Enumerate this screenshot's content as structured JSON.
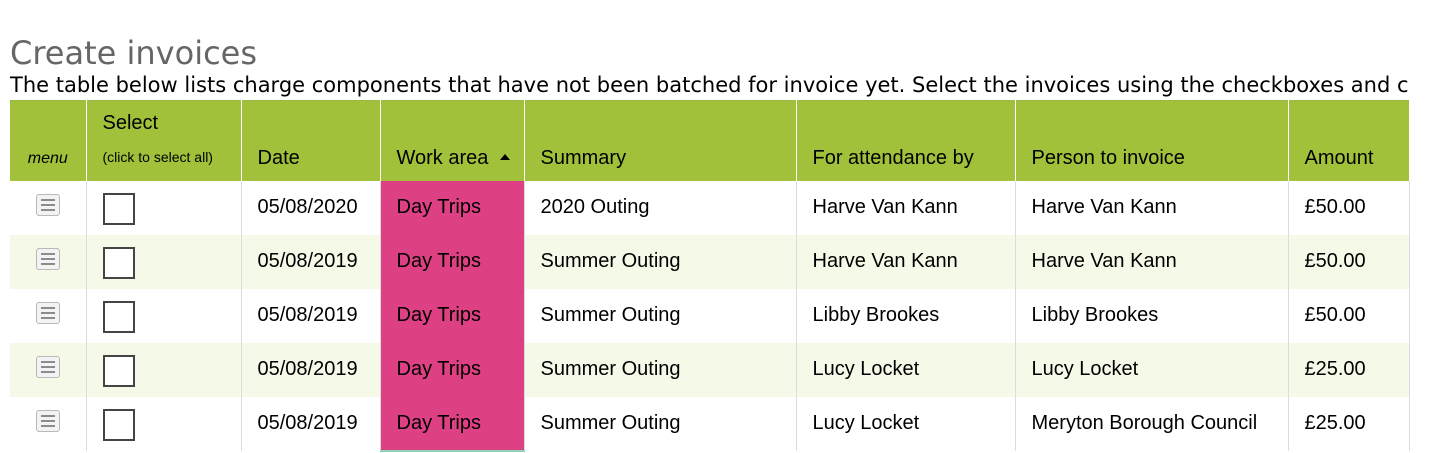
{
  "page": {
    "title": "Create invoices",
    "intro": "The table below lists charge components that have not been batched for invoice yet. Select the invoices using the checkboxes and c"
  },
  "table": {
    "headers": {
      "menu": "menu",
      "select": "Select",
      "select_hint": "(click to select all)",
      "date": "Date",
      "work_area": "Work area",
      "summary": "Summary",
      "attendance": "For attendance by",
      "person": "Person to invoice",
      "amount": "Amount"
    },
    "sort": {
      "column": "work_area",
      "direction": "ascending"
    },
    "rows": [
      {
        "date": "05/08/2020",
        "work_area": "Day Trips",
        "summary": "2020 Outing",
        "attendance": "Harve Van Kann",
        "person": "Harve Van Kann",
        "amount": "£50.00",
        "selected": false
      },
      {
        "date": "05/08/2019",
        "work_area": "Day Trips",
        "summary": "Summer Outing",
        "attendance": "Harve Van Kann",
        "person": "Harve Van Kann",
        "amount": "£50.00",
        "selected": false
      },
      {
        "date": "05/08/2019",
        "work_area": "Day Trips",
        "summary": "Summer Outing",
        "attendance": "Libby Brookes",
        "person": "Libby Brookes",
        "amount": "£50.00",
        "selected": false
      },
      {
        "date": "05/08/2019",
        "work_area": "Day Trips",
        "summary": "Summer Outing",
        "attendance": "Lucy Locket",
        "person": "Lucy Locket",
        "amount": "£25.00",
        "selected": false
      },
      {
        "date": "05/08/2019",
        "work_area": "Day Trips",
        "summary": "Summer Outing",
        "attendance": "Lucy Locket",
        "person": "Meryton Borough Council",
        "amount": "£25.00",
        "selected": false
      }
    ]
  },
  "colors": {
    "header_bg": "#a2c13b",
    "work_area_bg": "#de4183",
    "stripe_bg": "#f5f9e8",
    "title_text": "#666666"
  },
  "icons": {
    "row_menu": "row-menu-icon",
    "sort": "sort-ascending-icon",
    "checkbox": "checkbox-icon"
  }
}
